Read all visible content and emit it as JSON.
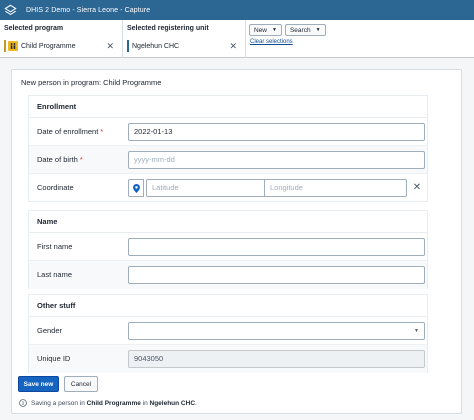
{
  "header": {
    "app_title": "DHIS 2 Demo - Sierra Leone - Capture"
  },
  "selection": {
    "program_label": "Selected program",
    "program_value": "Child Programme",
    "org_unit_label": "Selected registering unit",
    "org_unit_value": "Ngelehun CHC",
    "new_button": "New",
    "search_button": "Search",
    "clear_selections": "Clear selections"
  },
  "form": {
    "title": "New person in program: Child Programme",
    "enrollment": {
      "heading": "Enrollment",
      "date_of_enrollment_label": "Date of enrollment",
      "date_of_enrollment_value": "2022-01-13",
      "date_of_birth_label": "Date of birth",
      "date_of_birth_placeholder": "yyyy-mm-dd",
      "coordinate_label": "Coordinate",
      "latitude_placeholder": "Latitude",
      "longitude_placeholder": "Longitude"
    },
    "name": {
      "heading": "Name",
      "first_name_label": "First name",
      "last_name_label": "Last name"
    },
    "other": {
      "heading": "Other stuff",
      "gender_label": "Gender",
      "unique_id_label": "Unique ID",
      "unique_id_value": "9043050"
    },
    "required_marker": "*"
  },
  "footer": {
    "save_button": "Save new",
    "cancel_button": "Cancel",
    "info_prefix": "Saving a person in ",
    "info_program": "Child Programme",
    "info_middle": " in ",
    "info_org_unit": "Ngelehun CHC",
    "info_suffix": "."
  },
  "colors": {
    "header_bg": "#2c6693",
    "primary_button": "#1565c0",
    "required": "#d5372b",
    "program_icon": "#f0b71e"
  },
  "icons": {
    "logo": "dhis2-logo-icon",
    "program": "child-program-icon",
    "clear": "close-icon",
    "location": "location-pin-icon",
    "dropdown": "chevron-down-icon",
    "info": "info-icon"
  }
}
